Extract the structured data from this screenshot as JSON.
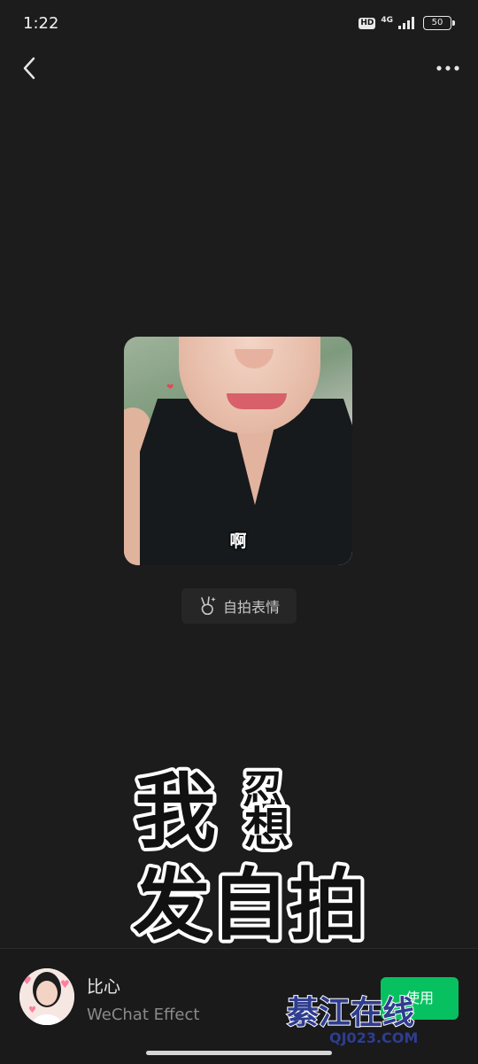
{
  "status_bar": {
    "time": "1:22",
    "hd": "HD",
    "network": "4G",
    "battery": "50"
  },
  "photo": {
    "caption": "啊"
  },
  "selfie_button": {
    "label": "自拍表情",
    "icon": "victory-hand-icon"
  },
  "sticker": {
    "line1_a": "我",
    "line1_b1": "忍",
    "line1_b2": "想",
    "line2": "发自拍"
  },
  "effect": {
    "title": "比心",
    "subtitle": "WeChat Effect",
    "use_label": "使用"
  },
  "watermark": {
    "text": "綦江在线",
    "url": "QJ023.COM"
  },
  "colors": {
    "background": "#1c1c1c",
    "accent": "#07c160"
  }
}
